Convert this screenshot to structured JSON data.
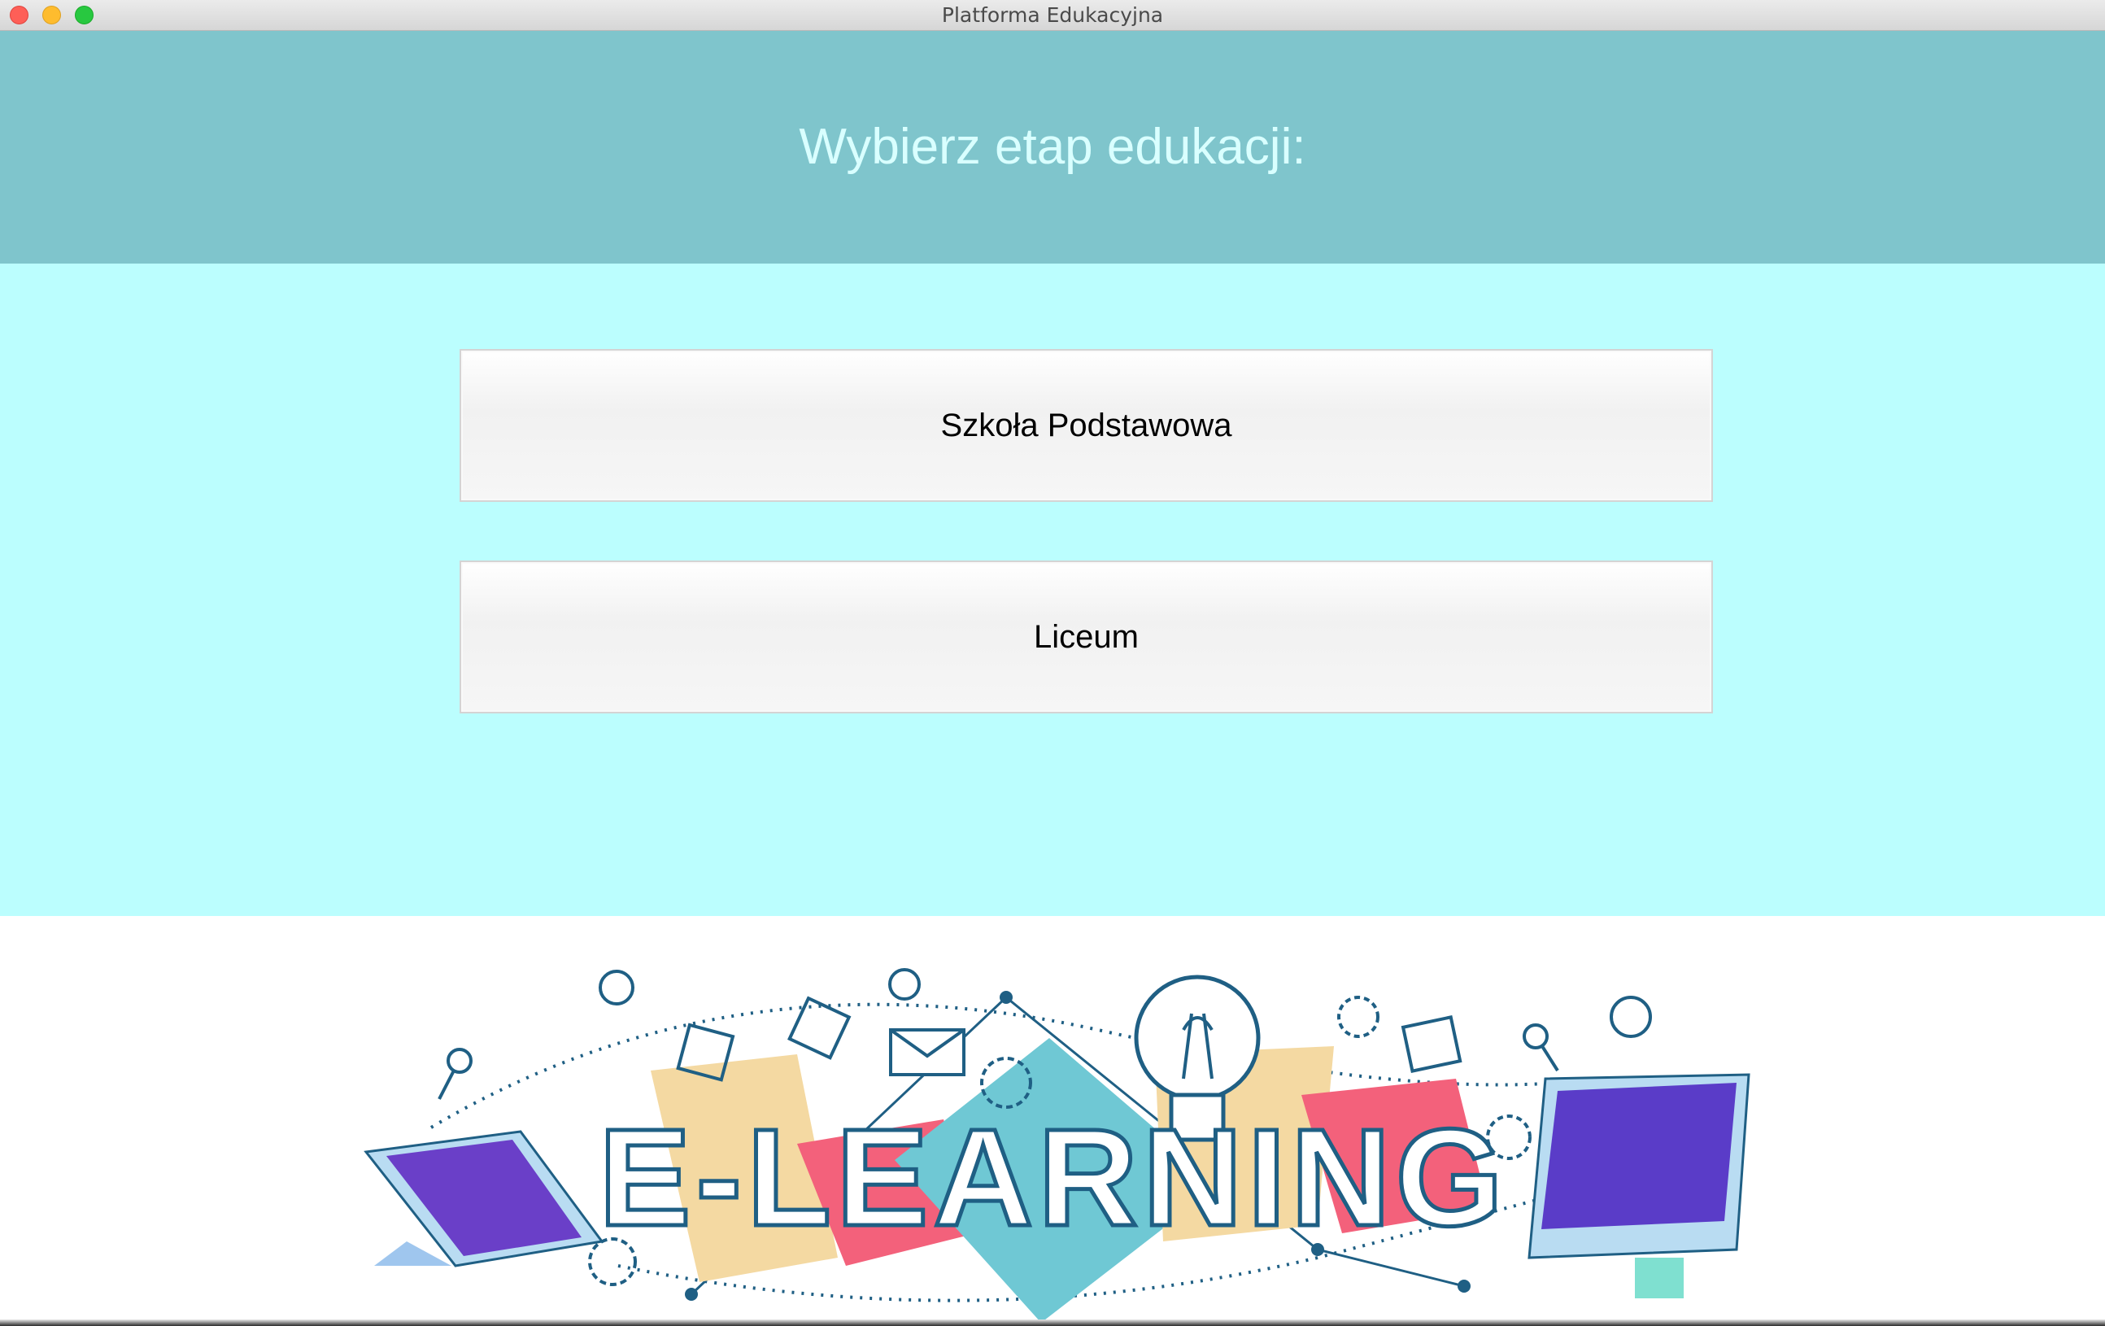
{
  "window": {
    "title": "Platforma Edukacyjna"
  },
  "header": {
    "title": "Wybierz etap edukacji:"
  },
  "stages": [
    {
      "label": "Szkoła Podstawowa"
    },
    {
      "label": "Liceum"
    }
  ],
  "banner": {
    "text": "E-LEARNING"
  },
  "colors": {
    "header_bg": "#7fc5cc",
    "header_text": "#d9ffff",
    "main_bg": "#bbfefe",
    "button_bg": "#f4f4f4"
  }
}
